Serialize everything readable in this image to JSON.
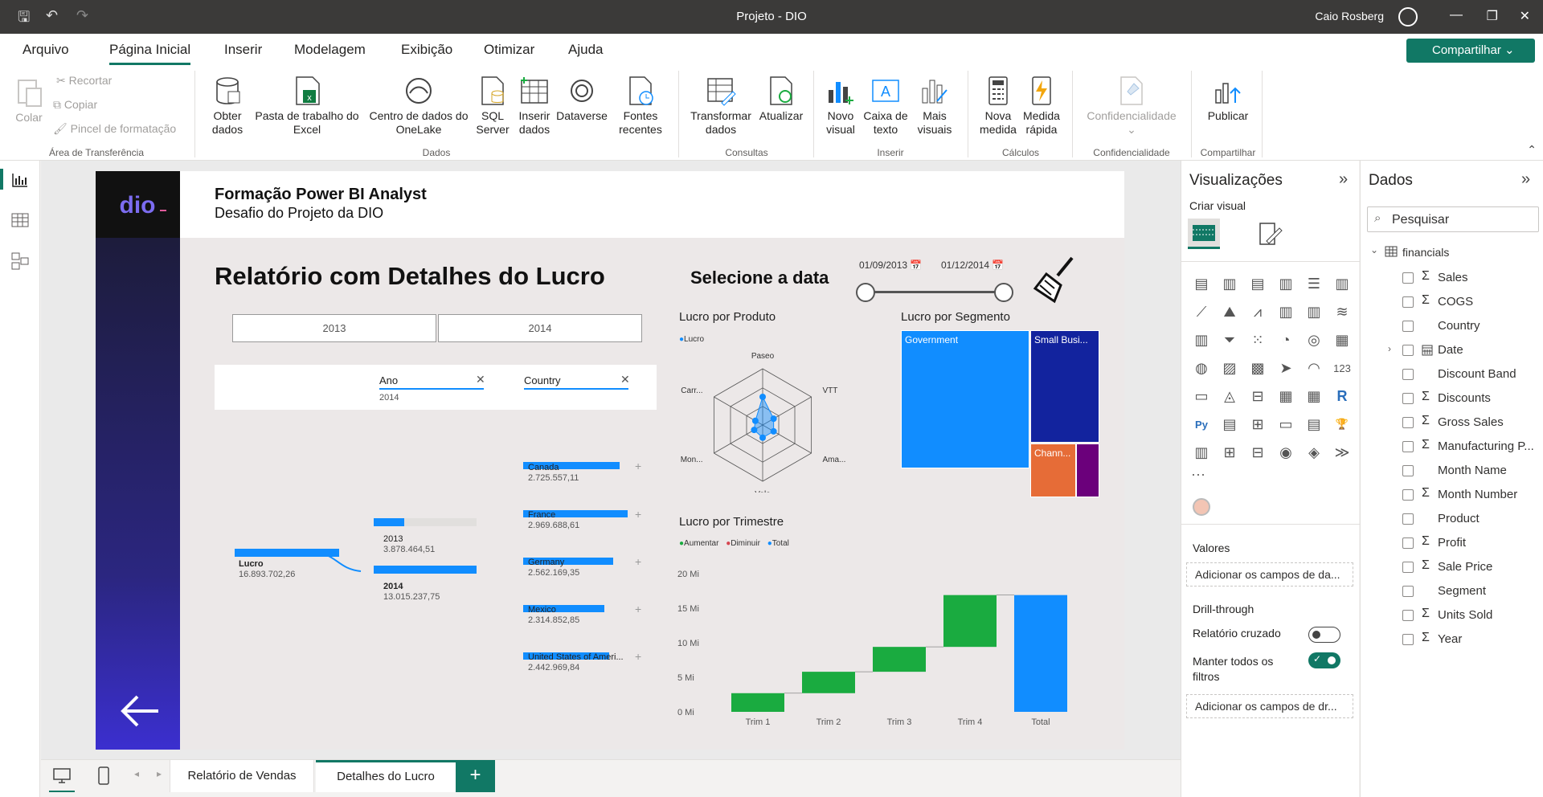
{
  "app": {
    "title": "Projeto - DIO",
    "user": "Caio Rosberg"
  },
  "menu": {
    "items": [
      "Arquivo",
      "Página Inicial",
      "Inserir",
      "Modelagem",
      "Exibição",
      "Otimizar",
      "Ajuda"
    ],
    "share": "Compartilhar"
  },
  "ribbon": {
    "clipboard": {
      "paste": "Colar",
      "cut": "Recortar",
      "copy": "Copiar",
      "format": "Pincel de formatação",
      "group": "Área de Transferência"
    },
    "data": {
      "get": "Obter\ndados",
      "excel": "Pasta de trabalho do\nExcel",
      "onelake": "Centro de dados do\nOneLake",
      "sql": "SQL\nServer",
      "insert": "Inserir\ndados",
      "dataverse": "Dataverse",
      "recent": "Fontes\nrecentes",
      "group": "Dados"
    },
    "queries": {
      "transform": "Transformar\ndados",
      "refresh": "Atualizar",
      "group": "Consultas"
    },
    "insert": {
      "visual": "Novo\nvisual",
      "textbox": "Caixa de\ntexto",
      "more": "Mais\nvisuais",
      "group": "Inserir"
    },
    "calc": {
      "measure": "Nova\nmedida",
      "quick": "Medida\nrápida",
      "group": "Cálculos"
    },
    "sensitivity": {
      "label": "Confidencialidade",
      "group": "Confidencialidade"
    },
    "share": {
      "publish": "Publicar",
      "group": "Compartilhar"
    }
  },
  "report": {
    "course": "Formação Power BI Analyst",
    "subtitle": "Desafio do Projeto da DIO",
    "heading": "Relatório com Detalhes do Lucro",
    "date_heading": "Selecione a data",
    "date_start": "01/09/2013",
    "date_end": "01/12/2014",
    "year_buttons": [
      "2013",
      "2014"
    ],
    "filter_ano": {
      "label": "Ano",
      "value": "2014"
    },
    "filter_country": {
      "label": "Country"
    }
  },
  "decomp": {
    "root": {
      "label": "Lucro",
      "value": "16.893.702,26"
    },
    "years": [
      {
        "label": "2013",
        "value": "3.878.464,51"
      },
      {
        "label": "2014",
        "value": "13.015.237,75"
      }
    ],
    "countries": [
      {
        "label": "Canada",
        "value": "2.725.557,11"
      },
      {
        "label": "France",
        "value": "2.969.688,61"
      },
      {
        "label": "Germany",
        "value": "2.562.169,35"
      },
      {
        "label": "Mexico",
        "value": "2.314.852,85"
      },
      {
        "label": "United States of Ameri...",
        "value": "2.442.969,84"
      }
    ]
  },
  "chart_data": [
    {
      "type": "radar",
      "title": "Lucro por Produto",
      "legend": [
        "Lucro"
      ],
      "categories": [
        "Paseo",
        "VTT",
        "Ama...",
        "Velo",
        "Mon...",
        "Carr..."
      ],
      "values": [
        1.0,
        0.45,
        0.45,
        0.45,
        0.35,
        0.3
      ]
    },
    {
      "type": "treemap",
      "title": "Lucro por Segmento",
      "categories": [
        "Government",
        "Small Busi...",
        "Chann...",
        ""
      ],
      "values": [
        54,
        30,
        9,
        7
      ]
    },
    {
      "type": "waterfall",
      "title": "Lucro por Trimestre",
      "legend": [
        "Aumentar",
        "Diminuir",
        "Total"
      ],
      "categories": [
        "Trim 1",
        "Trim 2",
        "Trim 3",
        "Trim 4",
        "Total"
      ],
      "values": [
        2.7,
        3.1,
        3.6,
        7.5,
        16.9
      ],
      "yticks": [
        "20 Mi",
        "15 Mi",
        "10 Mi",
        "5 Mi",
        "0 Mi"
      ],
      "ylim": [
        0,
        20
      ]
    }
  ],
  "viz_pane": {
    "title": "Visualizações",
    "create": "Criar visual",
    "values": "Valores",
    "add_values": "Adicionar os campos de da...",
    "drill": "Drill-through",
    "cross": "Relatório cruzado",
    "keep": "Manter todos os\nfiltros",
    "add_drill": "Adicionar os campos de dr..."
  },
  "data_pane": {
    "title": "Dados",
    "search": "Pesquisar",
    "table": "financials",
    "fields": [
      {
        "name": "Sales",
        "sigma": "Σ"
      },
      {
        "name": "COGS",
        "sigma": "Σ"
      },
      {
        "name": "Country",
        "sigma": ""
      },
      {
        "name": "Date",
        "sigma": "date"
      },
      {
        "name": "Discount Band",
        "sigma": ""
      },
      {
        "name": "Discounts",
        "sigma": "Σ"
      },
      {
        "name": "Gross Sales",
        "sigma": "Σ"
      },
      {
        "name": "Manufacturing P...",
        "sigma": "Σ"
      },
      {
        "name": "Month Name",
        "sigma": ""
      },
      {
        "name": "Month Number",
        "sigma": "Σ"
      },
      {
        "name": "Product",
        "sigma": ""
      },
      {
        "name": "Profit",
        "sigma": "Σ"
      },
      {
        "name": "Sale Price",
        "sigma": "Σ"
      },
      {
        "name": "Segment",
        "sigma": ""
      },
      {
        "name": "Units Sold",
        "sigma": "Σ"
      },
      {
        "name": "Year",
        "sigma": "Σ"
      }
    ]
  },
  "pages": [
    "Relatório de Vendas",
    "Detalhes do Lucro"
  ],
  "colors": {
    "accent": "#117865",
    "blue": "#118dff",
    "green": "#1aab40",
    "red": "#d64550"
  }
}
